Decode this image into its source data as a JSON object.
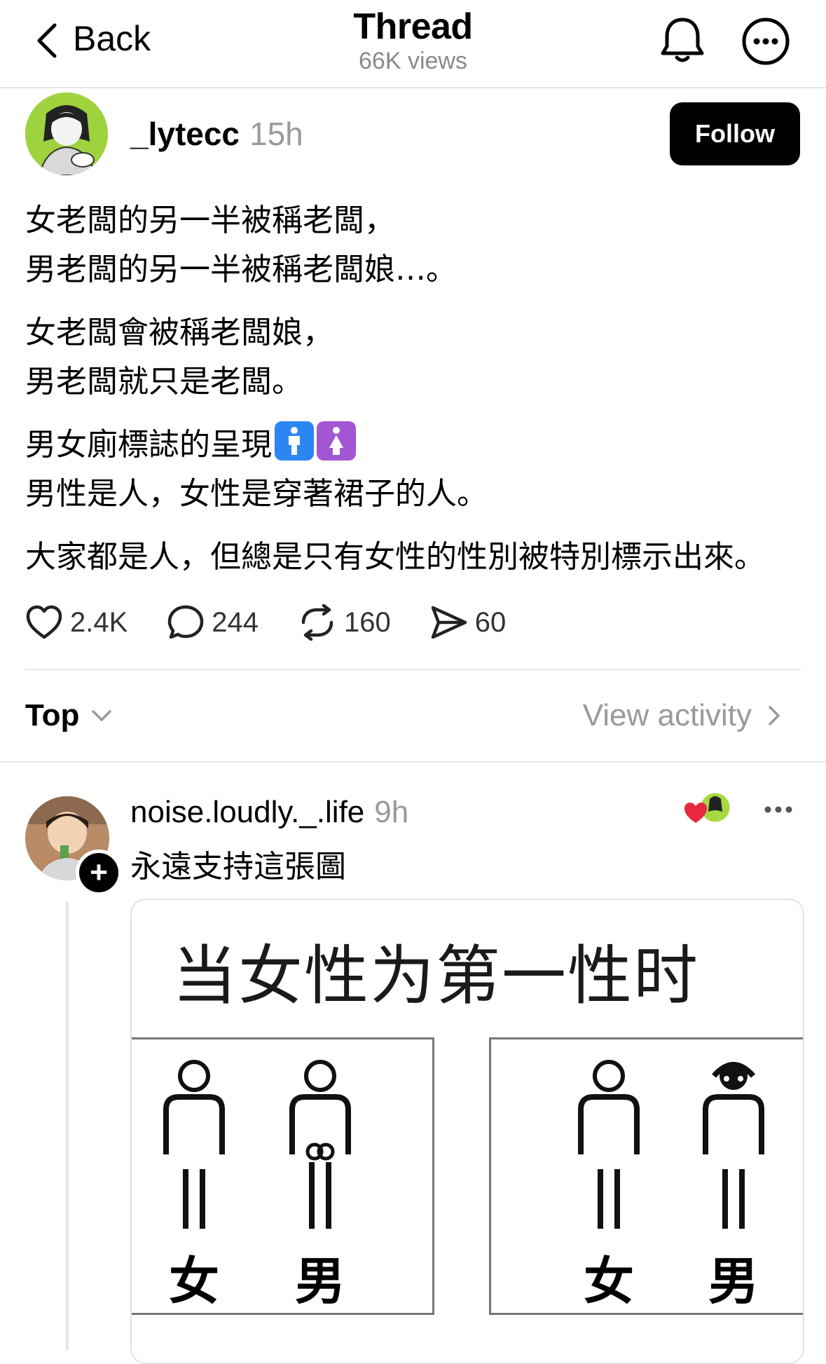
{
  "header": {
    "back_label": "Back",
    "title": "Thread",
    "views": "66K views"
  },
  "post": {
    "username": "_lytecc",
    "time": "15h",
    "follow_label": "Follow",
    "paragraphs": [
      "女老闆的另一半被稱老闆，",
      "男老闆的另一半被稱老闆娘…。",
      "女老闆會被稱老闆娘，",
      "男老闆就只是老闆。",
      "男女廁標誌的呈現",
      "男性是人，女性是穿著裙子的人。",
      "大家都是人，但總是只有女性的性別被特別標示出來。"
    ],
    "actions": {
      "likes": "2.4K",
      "comments": "244",
      "reposts": "160",
      "shares": "60"
    }
  },
  "sort": {
    "label": "Top",
    "view_activity": "View activity"
  },
  "reply": {
    "username": "noise.loudly._.life",
    "time": "9h",
    "text": "永遠支持這張圖",
    "image": {
      "title": "当女性为第一性时",
      "left_labels": [
        "女",
        "男"
      ],
      "right_labels": [
        "女",
        "男"
      ]
    }
  },
  "colors": {
    "men_icon": "#2b86f2",
    "women_icon": "#a356d2",
    "liked_heart": "#e8283f"
  }
}
